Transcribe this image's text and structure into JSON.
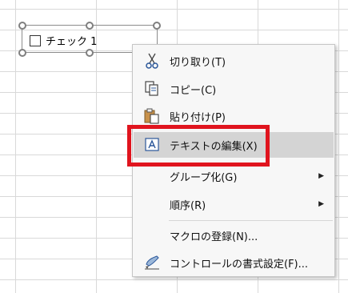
{
  "control": {
    "label": "チェック 1"
  },
  "menu": {
    "items": [
      {
        "label": "切り取り(T)",
        "icon": "scissors-icon"
      },
      {
        "label": "コピー(C)",
        "icon": "copy-icon"
      },
      {
        "label": "貼り付け(P)",
        "icon": "paste-icon"
      },
      {
        "label": "テキストの編集(X)",
        "icon": "edit-text-icon",
        "highlighted": true
      },
      {
        "label": "グループ化(G)",
        "submenu": true
      },
      {
        "label": "順序(R)",
        "submenu": true
      },
      {
        "label": "マクロの登録(N)..."
      },
      {
        "label": "コントロールの書式設定(F)...",
        "icon": "format-control-icon"
      }
    ],
    "submenu_arrow": "▶"
  },
  "colors": {
    "highlight_box": "#e0141e",
    "accent_blue": "#2b579a"
  }
}
